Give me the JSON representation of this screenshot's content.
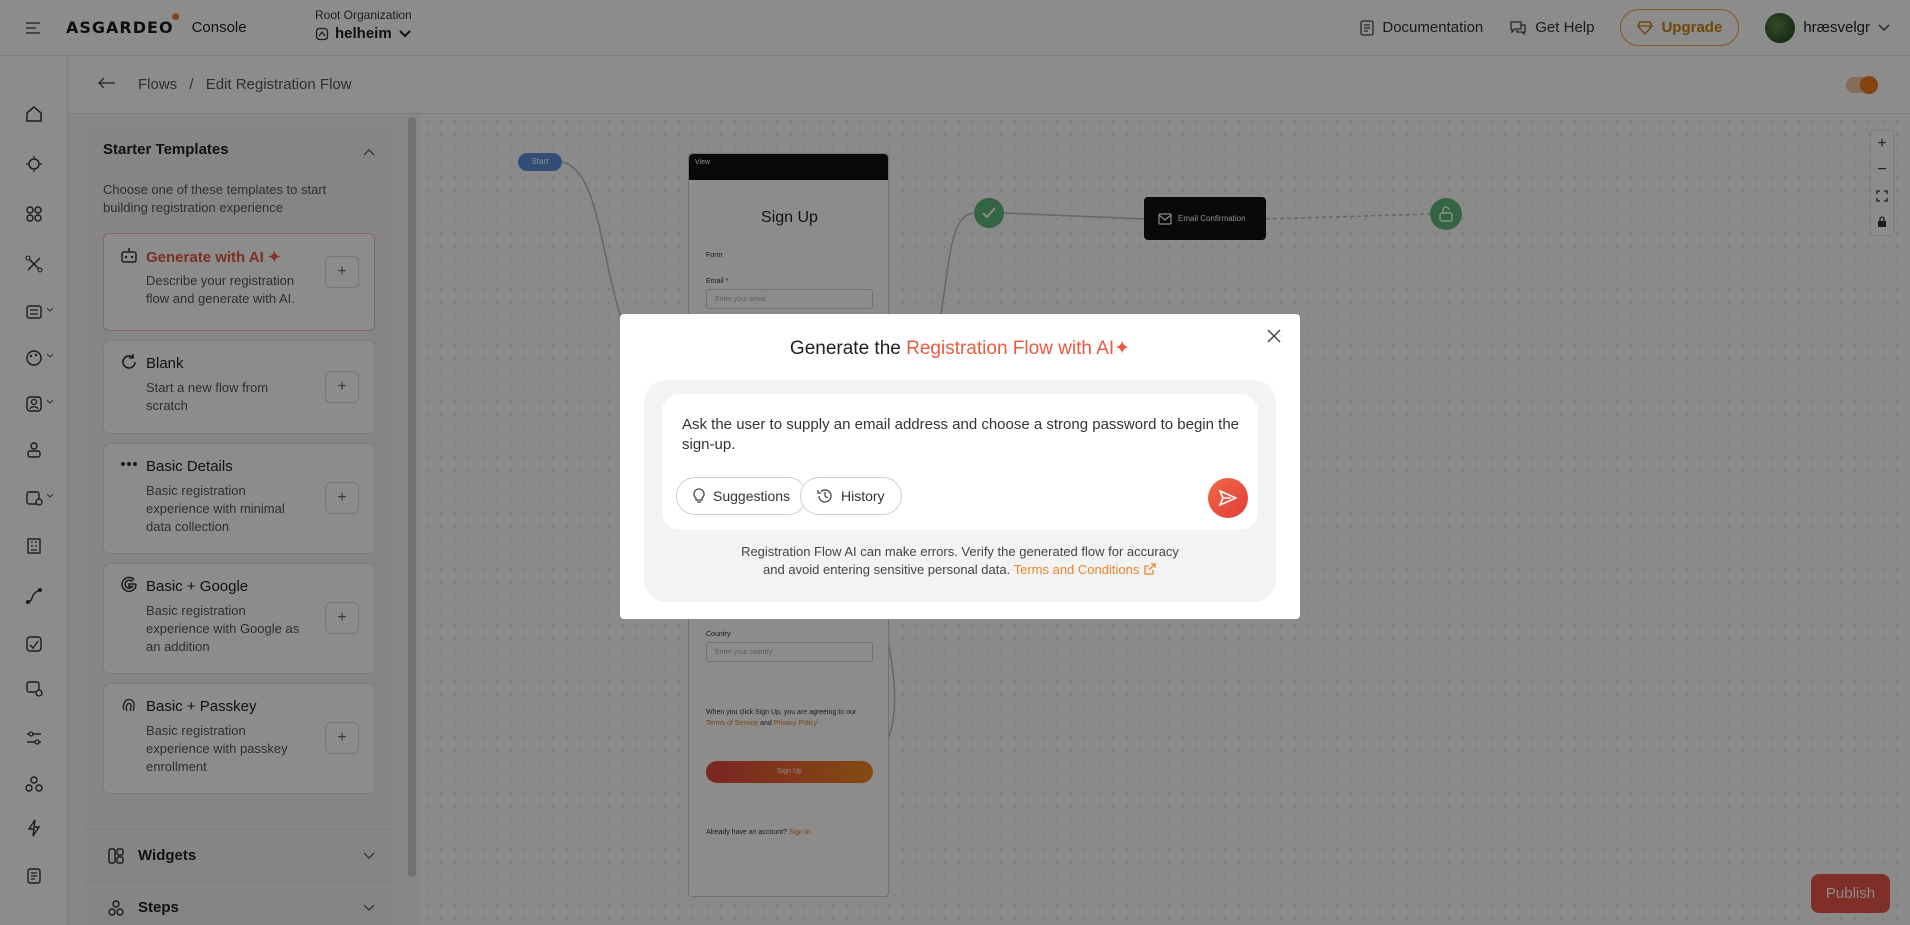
{
  "header": {
    "logo": "ASGARDEO",
    "product": "Console",
    "org_label": "Root Organization",
    "org_name": "helheim",
    "documentation": "Documentation",
    "get_help": "Get Help",
    "upgrade": "Upgrade",
    "username": "hræsvelgr"
  },
  "breadcrumb": {
    "parent": "Flows",
    "separator": "/",
    "current": "Edit Registration Flow"
  },
  "panel": {
    "title": "Starter Templates",
    "description": "Choose one of these templates to start building registration experience",
    "templates": [
      {
        "name": "Generate with AI",
        "description": "Describe your registration flow and generate with AI.",
        "icon": "robot-icon"
      },
      {
        "name": "Blank",
        "description": "Start a new flow from scratch",
        "icon": "refresh-icon"
      },
      {
        "name": "Basic Details",
        "description": "Basic registration experience with minimal data collection",
        "icon": "dots-icon"
      },
      {
        "name": "Basic + Google",
        "description": "Basic registration experience with Google as an addition",
        "icon": "google-icon"
      },
      {
        "name": "Basic + Passkey",
        "description": "Basic registration experience with passkey enrollment",
        "icon": "fingerprint-icon"
      }
    ],
    "accordions": [
      "Widgets",
      "Steps"
    ]
  },
  "canvas": {
    "start": "Start",
    "view_label": "View",
    "view_title": "Sign Up",
    "form_label": "Form",
    "email_label": "Email *",
    "email_placeholder": "Enter your email",
    "country_label": "Country",
    "country_placeholder": "Enter your country",
    "terms_prefix": "When you click Sign Up, you are agreeing to our",
    "terms_of_service": "Terms of Service",
    "terms_and": "and",
    "privacy_policy": "Privacy Policy",
    "signup_button": "Sign Up",
    "signin_prefix": "Already have an account?",
    "signin_link": "Sign In",
    "email_confirmation": "Email Confirmation",
    "publish": "Publish"
  },
  "modal": {
    "title_prefix": "Generate the",
    "title_highlight": "Registration Flow with AI",
    "prompt": "Ask the user to supply an email address and choose a strong password to begin the sign-up.",
    "suggestions": "Suggestions",
    "history": "History",
    "disclaimer_1": "Registration Flow AI can make errors. Verify the generated flow for accuracy",
    "disclaimer_2": "and avoid entering sensitive personal data.",
    "terms_link": "Terms and Conditions"
  },
  "colors": {
    "accent": "#ec5a3d",
    "brand_orange": "#f47b20",
    "upgrade_gold": "#c98211",
    "node_green": "#5fb878",
    "start_blue": "#5b8fd8"
  }
}
